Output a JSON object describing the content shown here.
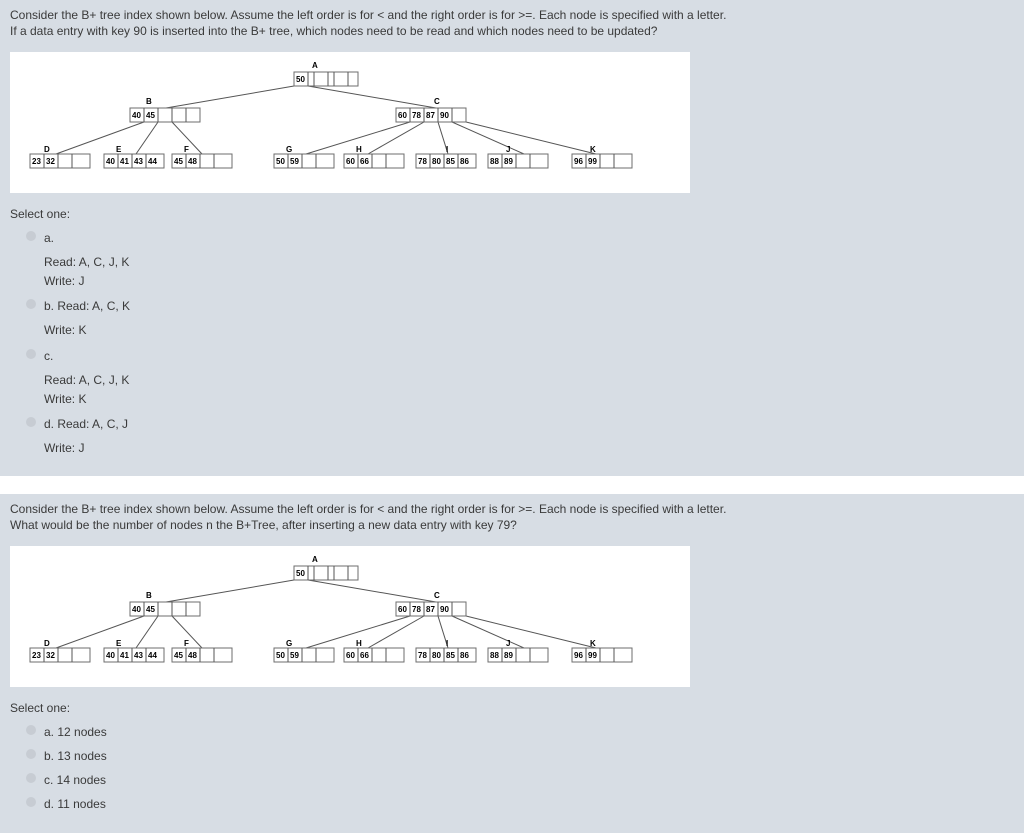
{
  "intro_line1": "Consider the B+ tree index shown below. Assume the left order is for < and the right order is for >=. Each node is specified with a letter.",
  "q1_line2": "If a data entry with key 90 is inserted into the B+ tree, which nodes need to be read and which nodes need to be updated?",
  "q2_line2": "What would be the number of nodes n the B+Tree, after inserting a new data entry with key 79?",
  "select_one": "Select one:",
  "tree": {
    "A": {
      "label": "A",
      "keys": [
        "50"
      ]
    },
    "B": {
      "label": "B",
      "keys": [
        "40",
        "45"
      ]
    },
    "C": {
      "label": "C",
      "keys": [
        "60",
        "78",
        "87",
        "90"
      ]
    },
    "D": {
      "label": "D",
      "keys": [
        "23",
        "32"
      ]
    },
    "E": {
      "label": "E",
      "keys": [
        "40",
        "41",
        "43",
        "44"
      ]
    },
    "F": {
      "label": "F",
      "keys": [
        "45",
        "48"
      ]
    },
    "G": {
      "label": "G",
      "keys": [
        "50",
        "59"
      ]
    },
    "H": {
      "label": "H",
      "keys": [
        "60",
        "66"
      ]
    },
    "I": {
      "label": "I",
      "keys": [
        "78",
        "80",
        "85",
        "86"
      ]
    },
    "J": {
      "label": "J",
      "keys": [
        "88",
        "89"
      ]
    },
    "K": {
      "label": "K",
      "keys": [
        "96",
        "99"
      ]
    }
  },
  "q1_opts": {
    "a_label": "a.",
    "a_line1": "Read: A, C, J, K",
    "a_line2": "Write: J",
    "b_label": "b. Read: A, C, K",
    "b_line2": "Write: K",
    "c_label": "c.",
    "c_line1": "Read: A, C, J, K",
    "c_line2": "Write: K",
    "d_label": "d. Read: A, C, J",
    "d_line2": "Write: J"
  },
  "q2_opts": {
    "a": "a. 12 nodes",
    "b": "b. 13 nodes",
    "c": "c. 14 nodes",
    "d": "d. 11 nodes"
  }
}
